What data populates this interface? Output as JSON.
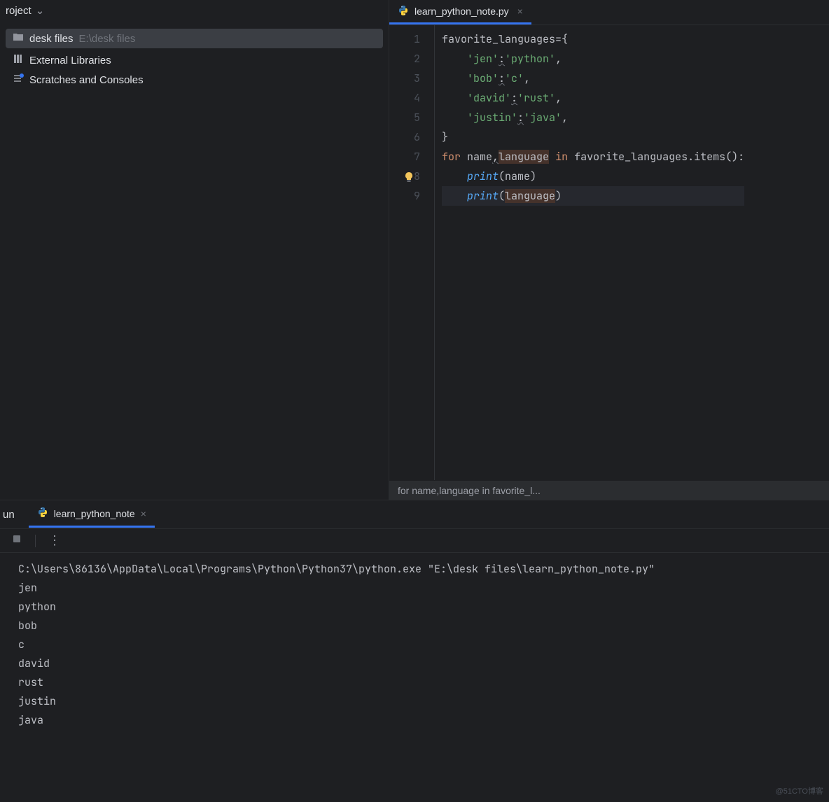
{
  "sidebar": {
    "header": "roject",
    "items": [
      {
        "label": "desk files",
        "path": "E:\\desk files"
      },
      {
        "label": "External Libraries"
      },
      {
        "label": "Scratches and Consoles"
      }
    ]
  },
  "editor": {
    "tab": {
      "title": "learn_python_note.py"
    },
    "lines": [
      {
        "n": "1",
        "indent": "",
        "tokens": [
          [
            "",
            "favorite_languages"
          ],
          [
            "punct",
            "="
          ],
          [
            "punct",
            "{"
          ]
        ]
      },
      {
        "n": "2",
        "indent": "    ",
        "tokens": [
          [
            "str",
            "'jen'"
          ],
          [
            "underline",
            ":"
          ],
          [
            "str",
            "'python'"
          ],
          [
            "punct",
            ","
          ]
        ]
      },
      {
        "n": "3",
        "indent": "    ",
        "tokens": [
          [
            "str",
            "'bob'"
          ],
          [
            "underline",
            ":"
          ],
          [
            "str",
            "'c'"
          ],
          [
            "punct",
            ","
          ]
        ]
      },
      {
        "n": "4",
        "indent": "    ",
        "tokens": [
          [
            "str",
            "'david'"
          ],
          [
            "underline",
            ":"
          ],
          [
            "str",
            "'rust'"
          ],
          [
            "punct",
            ","
          ]
        ]
      },
      {
        "n": "5",
        "indent": "    ",
        "tokens": [
          [
            "str",
            "'justin'"
          ],
          [
            "underline",
            ":"
          ],
          [
            "str",
            "'java'"
          ],
          [
            "punct",
            ","
          ]
        ]
      },
      {
        "n": "6",
        "indent": "",
        "tokens": [
          [
            "punct",
            "}"
          ]
        ]
      },
      {
        "n": "7",
        "indent": "",
        "tokens": [
          [
            "kw",
            "for"
          ],
          [
            "",
            " name"
          ],
          [
            "underline",
            ","
          ],
          [
            "hl",
            "language"
          ],
          [
            "",
            " "
          ],
          [
            "kw",
            "in"
          ],
          [
            "",
            " favorite_languages.items():"
          ]
        ]
      },
      {
        "n": "8",
        "indent": "    ",
        "bulb": true,
        "tokens": [
          [
            "fn",
            "print"
          ],
          [
            "punct",
            "("
          ],
          [
            "",
            "name"
          ],
          [
            "punct",
            ")"
          ]
        ]
      },
      {
        "n": "9",
        "indent": "    ",
        "current": true,
        "tokens": [
          [
            "fn",
            "print"
          ],
          [
            "punct",
            "("
          ],
          [
            "hl",
            "language"
          ],
          [
            "punct",
            ")"
          ]
        ]
      }
    ],
    "breadcrumb": "for name,language in favorite_l..."
  },
  "run": {
    "label": "un",
    "tab": "learn_python_note",
    "dots": "⋮",
    "output": [
      "C:\\Users\\86136\\AppData\\Local\\Programs\\Python\\Python37\\python.exe \"E:\\desk files\\learn_python_note.py\"",
      "jen",
      "python",
      "bob",
      "c",
      "david",
      "rust",
      "justin",
      "java"
    ]
  },
  "watermark": "@51CTO博客"
}
